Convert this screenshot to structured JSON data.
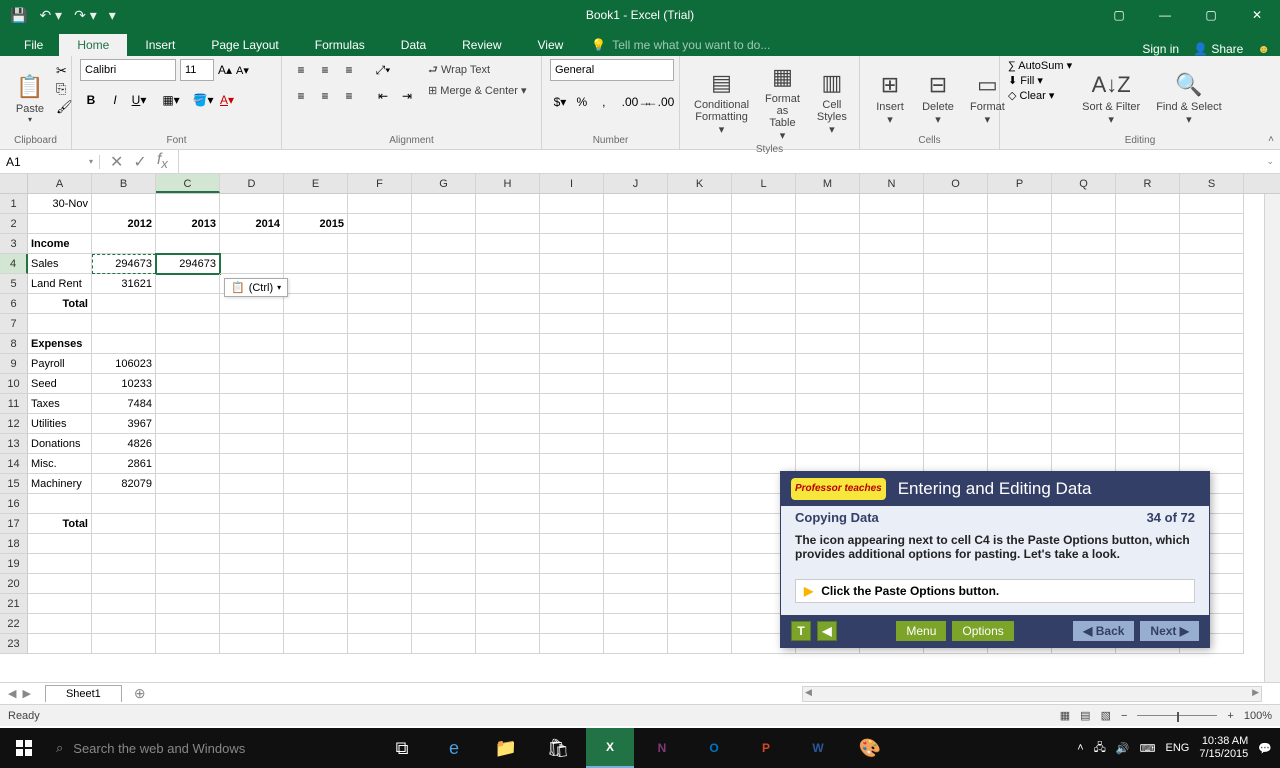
{
  "titlebar": {
    "title": "Book1 - Excel (Trial)"
  },
  "tabs": {
    "file": "File",
    "items": [
      "Home",
      "Insert",
      "Page Layout",
      "Formulas",
      "Data",
      "Review",
      "View"
    ],
    "active": "Home",
    "tellme": "Tell me what you want to do...",
    "signin": "Sign in",
    "share": "Share"
  },
  "ribbon": {
    "clipboard": {
      "label": "Clipboard",
      "paste": "Paste"
    },
    "font": {
      "label": "Font",
      "name": "Calibri",
      "size": "11"
    },
    "alignment": {
      "label": "Alignment",
      "wrap": "Wrap Text",
      "merge": "Merge & Center"
    },
    "number": {
      "label": "Number",
      "format": "General"
    },
    "styles": {
      "label": "Styles",
      "cond": "Conditional Formatting",
      "table": "Format as Table",
      "cell": "Cell Styles"
    },
    "cells": {
      "label": "Cells",
      "insert": "Insert",
      "delete": "Delete",
      "format": "Format"
    },
    "editing": {
      "label": "Editing",
      "autosum": "AutoSum",
      "fill": "Fill",
      "clear": "Clear",
      "sort": "Sort & Filter",
      "find": "Find & Select"
    }
  },
  "namebox": {
    "ref": "A1"
  },
  "columns": [
    "A",
    "B",
    "C",
    "D",
    "E",
    "F",
    "G",
    "H",
    "I",
    "J",
    "K",
    "L",
    "M",
    "N",
    "O",
    "P",
    "Q",
    "R",
    "S"
  ],
  "rows_count": 23,
  "sheet_data": {
    "A1": {
      "v": "30-Nov",
      "align": "right"
    },
    "B2": {
      "v": "2012",
      "align": "right",
      "bold": true
    },
    "C2": {
      "v": "2013",
      "align": "right",
      "bold": true
    },
    "D2": {
      "v": "2014",
      "align": "right",
      "bold": true
    },
    "E2": {
      "v": "2015",
      "align": "right",
      "bold": true
    },
    "A3": {
      "v": "Income",
      "bold": true
    },
    "A4": {
      "v": "Sales"
    },
    "B4": {
      "v": "294673",
      "align": "right"
    },
    "C4": {
      "v": "294673",
      "align": "right"
    },
    "A5": {
      "v": "Land Rent"
    },
    "B5": {
      "v": "31621",
      "align": "right"
    },
    "A6": {
      "v": "Total",
      "align": "right",
      "bold": true
    },
    "A8": {
      "v": "Expenses",
      "bold": true
    },
    "A9": {
      "v": "Payroll"
    },
    "B9": {
      "v": "106023",
      "align": "right"
    },
    "A10": {
      "v": "Seed"
    },
    "B10": {
      "v": "10233",
      "align": "right"
    },
    "A11": {
      "v": "Taxes"
    },
    "B11": {
      "v": "7484",
      "align": "right"
    },
    "A12": {
      "v": "Utilities"
    },
    "B12": {
      "v": "3967",
      "align": "right"
    },
    "A13": {
      "v": "Donations"
    },
    "B13": {
      "v": "4826",
      "align": "right"
    },
    "A14": {
      "v": "Misc."
    },
    "B14": {
      "v": "2861",
      "align": "right"
    },
    "A15": {
      "v": "Machinery"
    },
    "B15": {
      "v": "82079",
      "align": "right"
    },
    "A17": {
      "v": "Total",
      "align": "right",
      "bold": true
    }
  },
  "paste_options": "(Ctrl)",
  "sheet": {
    "name": "Sheet1"
  },
  "statusbar": {
    "status": "Ready",
    "zoom": "100%"
  },
  "taskbar": {
    "search": "Search the web and Windows",
    "lang": "ENG",
    "time": "10:38 AM",
    "date": "7/15/2015"
  },
  "tutorial": {
    "logo": "Professor teaches",
    "title": "Entering and Editing Data",
    "section": "Copying Data",
    "progress": "34 of 72",
    "body": "The icon appearing next to cell C4 is the Paste Options button, which provides additional options for pasting. Let's take a look.",
    "instruction": "Click the Paste Options button.",
    "menu": "Menu",
    "options": "Options",
    "back": "◀ Back",
    "next": "Next ▶"
  }
}
